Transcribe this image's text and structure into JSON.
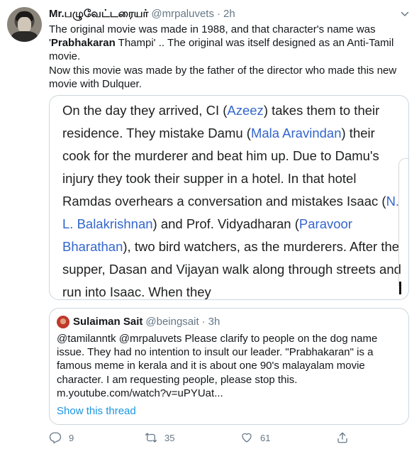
{
  "tweet": {
    "display_name": "Mr.பழுவேட்டரையர்",
    "handle": "@mrpaluvets",
    "separator": "·",
    "time": "2h",
    "text_line1": "The original movie was made in 1988, and that character's name was",
    "text_bold": "Prabhakaran",
    "text_line2_rest": " Thampi' .. The original was itself designed as an Anti-Tamil",
    "text_quote_open": "'",
    "text_line3": "movie.",
    "text_line4": "Now this movie was made by the father of the director who made this new movie with Dulquer."
  },
  "media": {
    "p1": "On the day they arrived, CI (",
    "l1": "Azeez",
    "p2": ") takes them to their residence. They mistake Damu (",
    "l2": "Mala Aravindan",
    "p3": ") their cook for the murderer and beat him up. Due to Damu's injury they took their supper in a hotel. In that hotel Ramdas overhears a conversation and mistakes Isaac (",
    "l3": "N. L. Balakrishnan",
    "p4": ") and Prof. Vidyadharan (",
    "l4": "Paravoor Bharathan",
    "p5": "), two bird watchers, as the murderers. After the supper, Dasan and Vijayan walk along through streets and run into Isaac. When they"
  },
  "quote": {
    "display_name": "Sulaiman Sait",
    "handle": "@beingsait",
    "separator": "·",
    "time": "3h",
    "text": "@tamilanntk @mrpaluvets  Please clarify to people on the dog name issue. They had no intention to insult our leader. \"Prabhakaran\" is a famous meme in kerala and it is about one 90's malayalam movie character. I am requesting people, please stop this. m.youtube.com/watch?v=uPYUat...",
    "show_thread": "Show this thread"
  },
  "actions": {
    "reply_count": "9",
    "retweet_count": "35",
    "like_count": "61"
  },
  "icons": {
    "reply": "reply-icon",
    "retweet": "retweet-icon",
    "like": "heart-icon",
    "share": "share-icon",
    "caret": "chevron-down-icon"
  },
  "colors": {
    "link": "#1b95e0",
    "wiki_link": "#3366cc",
    "secondary_text": "#657786",
    "border": "#ccd6dd"
  }
}
